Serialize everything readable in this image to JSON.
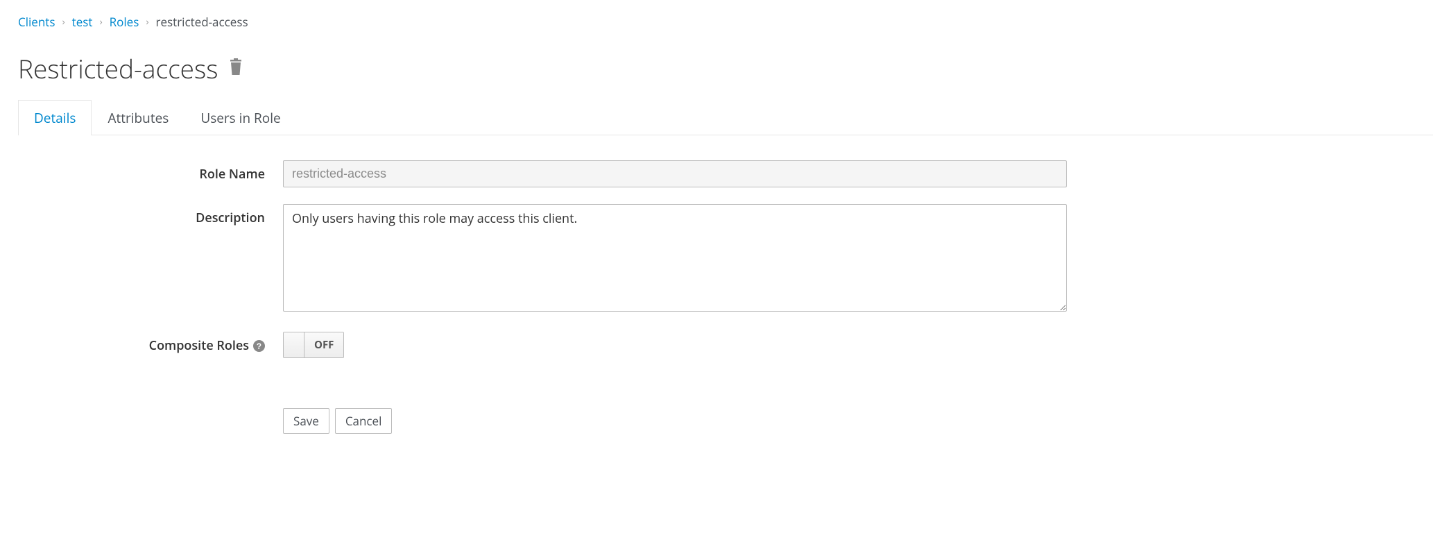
{
  "breadcrumb": {
    "items": [
      {
        "label": "Clients",
        "link": true
      },
      {
        "label": "test",
        "link": true
      },
      {
        "label": "Roles",
        "link": true
      },
      {
        "label": "restricted-access",
        "link": false
      }
    ]
  },
  "header": {
    "title": "Restricted-access"
  },
  "tabs": [
    {
      "label": "Details",
      "active": true
    },
    {
      "label": "Attributes",
      "active": false
    },
    {
      "label": "Users in Role",
      "active": false
    }
  ],
  "form": {
    "roleName": {
      "label": "Role Name",
      "value": "restricted-access"
    },
    "description": {
      "label": "Description",
      "value": "Only users having this role may access this client."
    },
    "compositeRoles": {
      "label": "Composite Roles",
      "value": "OFF"
    },
    "buttons": {
      "save": "Save",
      "cancel": "Cancel"
    }
  }
}
